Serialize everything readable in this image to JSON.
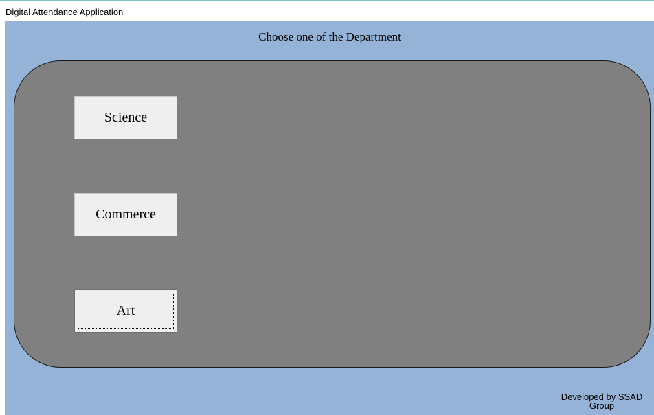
{
  "window": {
    "title": "Digital Attendance Application"
  },
  "main": {
    "heading": "Choose one of the Department",
    "departments": [
      {
        "label": "Science"
      },
      {
        "label": "Commerce"
      },
      {
        "label": "Art"
      }
    ],
    "focused_department": "Art"
  },
  "footer": {
    "line1": "Developed by SSAD",
    "line2": "Group"
  },
  "colors": {
    "background": "#95b3d6",
    "panel": "#808080",
    "button_face": "#efefef"
  }
}
